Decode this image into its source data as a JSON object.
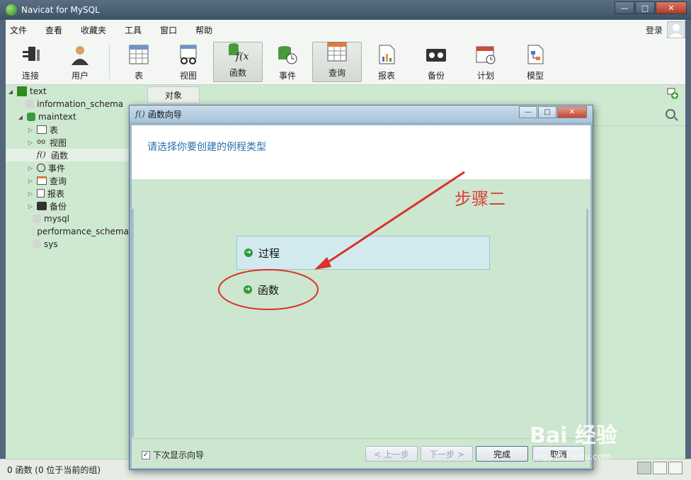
{
  "window": {
    "title": "Navicat for MySQL",
    "minimize": "—",
    "maximize": "□",
    "close": "✕"
  },
  "menu": {
    "items": [
      "文件",
      "查看",
      "收藏夹",
      "工具",
      "窗口",
      "帮助"
    ],
    "login": "登录"
  },
  "toolbar": {
    "items": [
      {
        "label": "连接",
        "icon": "plug-icon"
      },
      {
        "label": "用户",
        "icon": "user-icon"
      },
      {
        "label": "表",
        "icon": "table-icon"
      },
      {
        "label": "视图",
        "icon": "view-icon"
      },
      {
        "label": "函数",
        "icon": "function-icon",
        "active": true
      },
      {
        "label": "事件",
        "icon": "event-icon"
      },
      {
        "label": "查询",
        "icon": "query-icon",
        "active": true
      },
      {
        "label": "报表",
        "icon": "report-icon"
      },
      {
        "label": "备份",
        "icon": "backup-icon"
      },
      {
        "label": "计划",
        "icon": "schedule-icon"
      },
      {
        "label": "模型",
        "icon": "model-icon"
      }
    ]
  },
  "navigator": {
    "connection": "text",
    "databases": {
      "information_schema": "information_schema",
      "maintext": "maintext",
      "mysql": "mysql",
      "performance_schema": "performance_schema",
      "sys": "sys"
    },
    "children": {
      "tables": "表",
      "views": "视图",
      "functions": "函数",
      "events": "事件",
      "queries": "查询",
      "reports": "报表",
      "backups": "备份"
    }
  },
  "objects": {
    "tab": "对象"
  },
  "status": {
    "text": "0 函数 (0 位于当前的组)"
  },
  "dialog": {
    "title": "函数向导",
    "fx_glyph": "f()",
    "prompt": "请选择你要创建的例程类型",
    "options": [
      "过程",
      "函数"
    ],
    "annotation": "步骤二",
    "show_next_time": "下次显示向导",
    "checked": "✓",
    "buttons": {
      "prev": "< 上一步",
      "next": "下一步 >",
      "finish": "完成",
      "cancel": "取消"
    }
  },
  "watermark": {
    "main": "Bai 经验",
    "sub": "jingyan.baidu.com"
  }
}
